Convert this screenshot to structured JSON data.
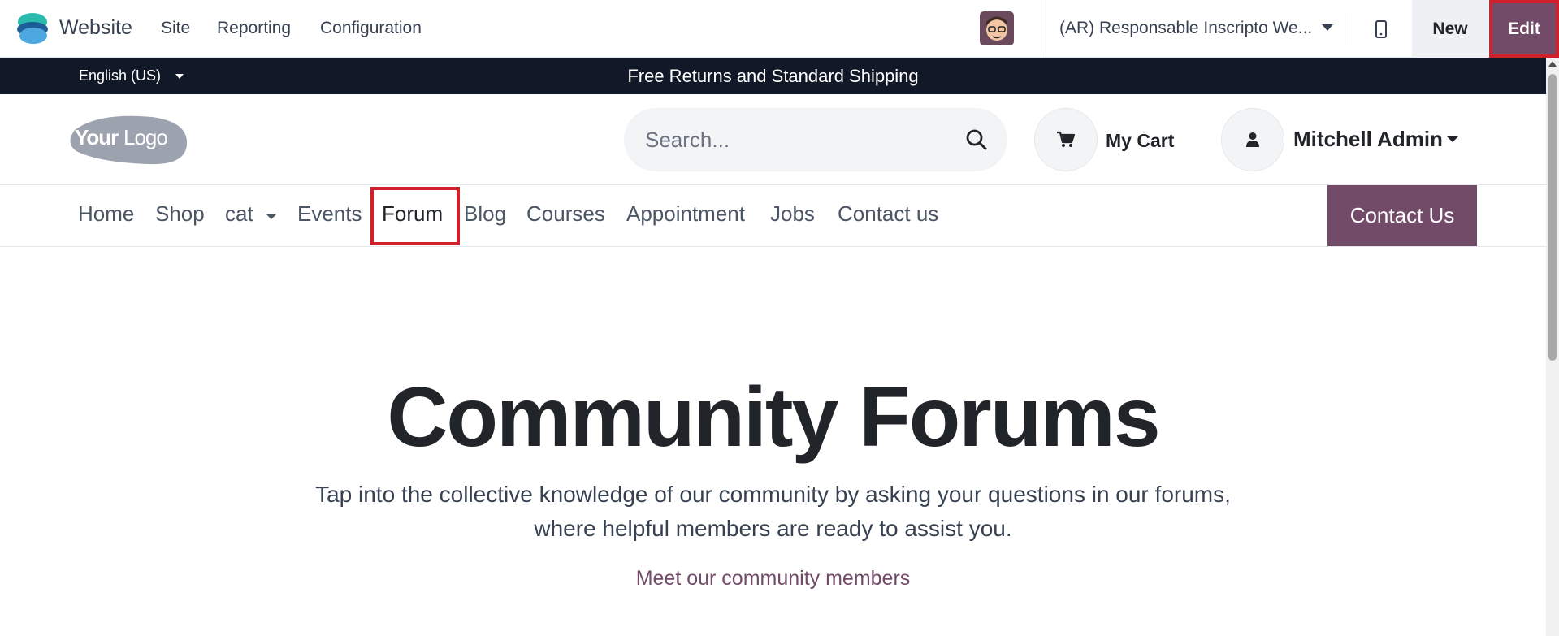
{
  "topbar": {
    "app_name": "Website",
    "menu": [
      "Site",
      "Reporting",
      "Configuration"
    ],
    "company": "(AR) Responsable Inscripto We...",
    "new_label": "New",
    "edit_label": "Edit"
  },
  "announcement": {
    "language": "English (US)",
    "text": "Free Returns and Standard Shipping"
  },
  "header": {
    "logo_text": "YourLogo",
    "search_placeholder": "Search...",
    "cart_label": "My Cart",
    "user_name": "Mitchell Admin"
  },
  "nav": {
    "items": [
      "Home",
      "Shop",
      "cat",
      "Events",
      "Forum",
      "Blog",
      "Courses",
      "Appointment",
      "Jobs",
      "Contact us"
    ],
    "active": "Forum",
    "cta_label": "Contact Us"
  },
  "hero": {
    "title": "Community Forums",
    "subtitle_line1": "Tap into the collective knowledge of our community by asking your questions in our forums,",
    "subtitle_line2": "where helpful members are ready to assist you.",
    "link": "Meet our community members"
  },
  "colors": {
    "brand": "#714b67",
    "dark_bar": "#111827",
    "highlight": "#d0202b"
  }
}
